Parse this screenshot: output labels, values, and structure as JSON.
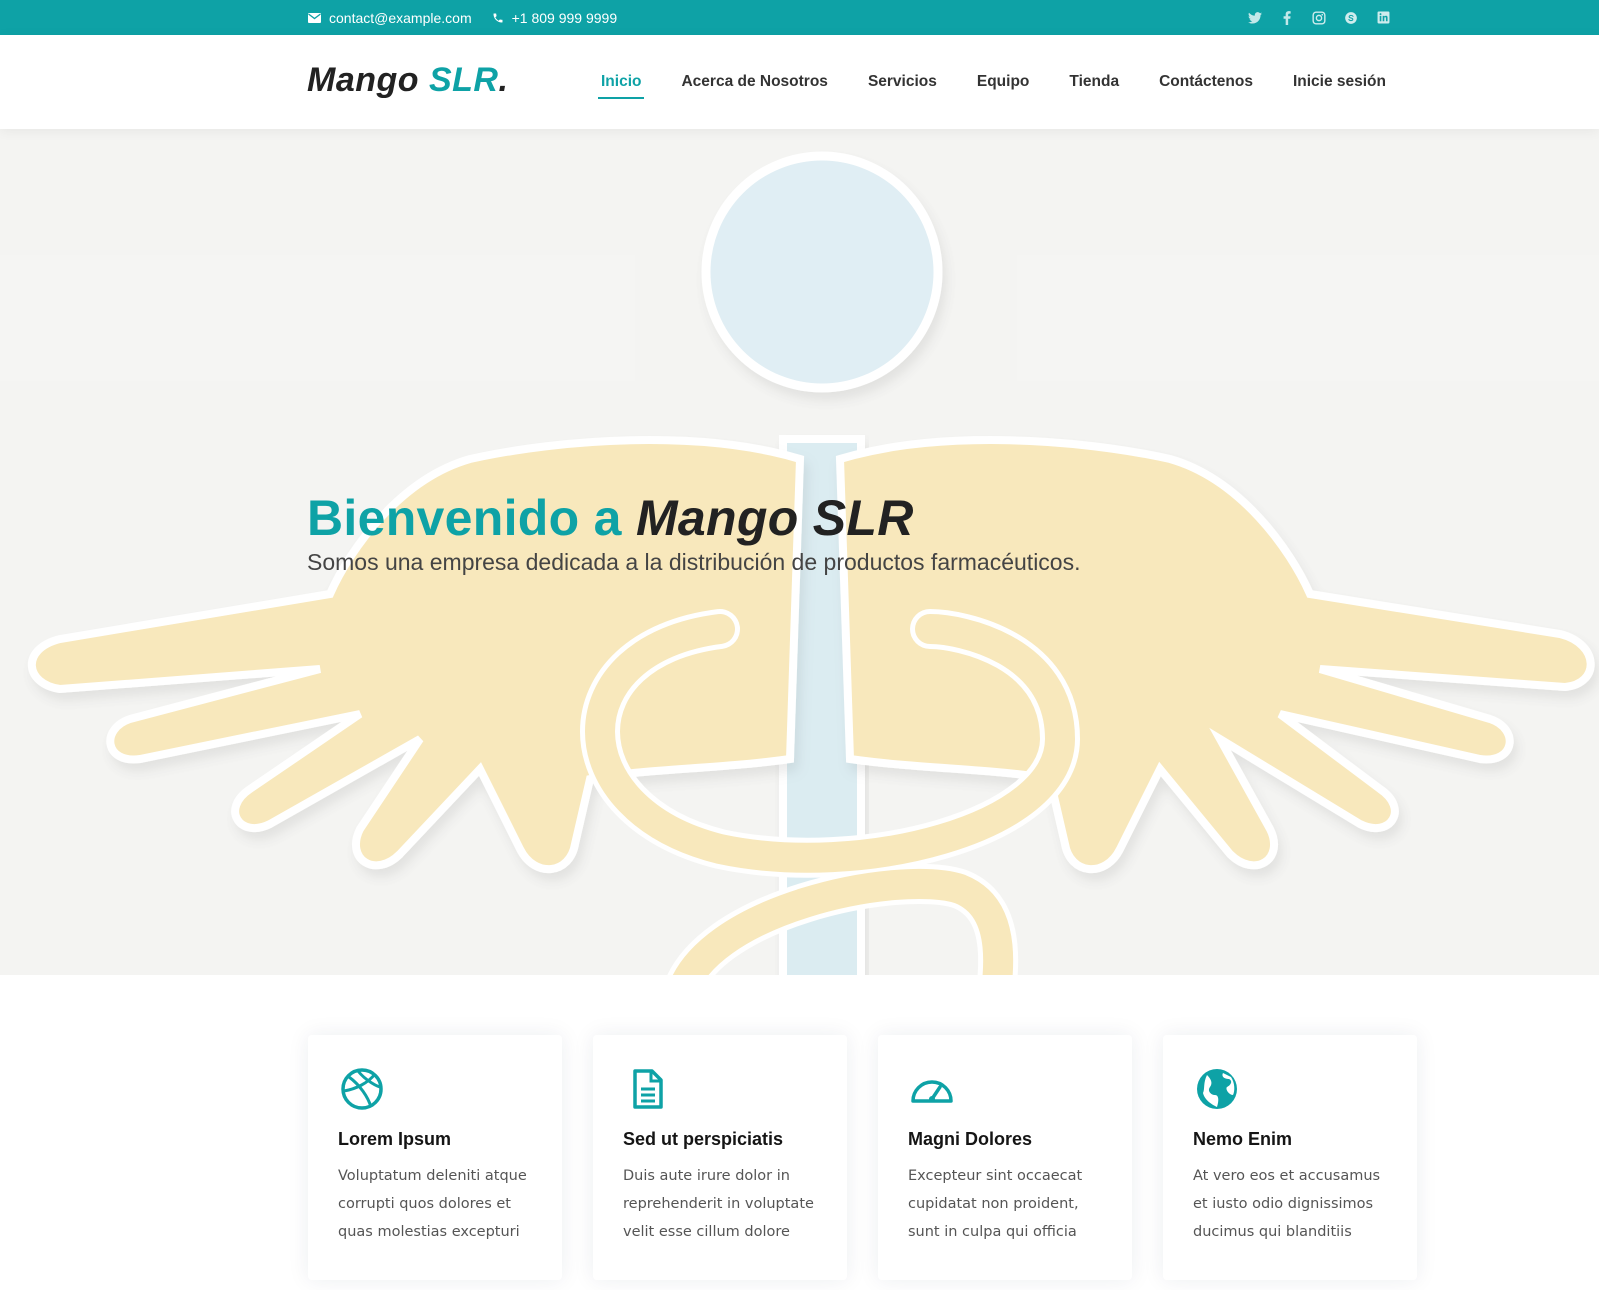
{
  "topbar": {
    "email": "contact@example.com",
    "phone": "+1 809 999 9999",
    "social_icons": [
      "twitter-icon",
      "facebook-icon",
      "instagram-icon",
      "skype-icon",
      "linkedin-icon"
    ]
  },
  "header": {
    "logo_main": "Mango ",
    "logo_accent": "SLR",
    "logo_dot": ".",
    "nav": [
      {
        "label": "Inicio",
        "active": true
      },
      {
        "label": "Acerca de Nosotros"
      },
      {
        "label": "Servicios"
      },
      {
        "label": "Equipo"
      },
      {
        "label": "Tienda"
      },
      {
        "label": "Contáctenos"
      },
      {
        "label": "Inicie sesión"
      }
    ]
  },
  "hero": {
    "title_prefix": "Bienvenido a ",
    "title_name": "Mango SLR",
    "subtitle": "Somos una empresa dedicada a la distribución de productos farmacéuticos."
  },
  "features": [
    {
      "icon": "dribbble-icon",
      "title": "Lorem Ipsum",
      "text_lines": [
        "Voluptatum deleniti atque",
        "corrupti quos dolores et",
        "quas molestias excepturi"
      ]
    },
    {
      "icon": "document-icon",
      "title": "Sed ut perspiciatis",
      "text_lines": [
        "Duis aute irure dolor in",
        "reprehenderit in voluptate",
        "velit esse cillum dolore"
      ]
    },
    {
      "icon": "speedometer-icon",
      "title": "Magni Dolores",
      "text_lines": [
        "Excepteur sint occaecat",
        "cupidatat non proident,",
        "sunt in culpa qui officia"
      ]
    },
    {
      "icon": "globe-icon",
      "title": "Nemo Enim",
      "text_lines": [
        "At vero eos et accusamus",
        "et iusto odio dignissimos",
        "ducimus qui blanditiis"
      ]
    }
  ],
  "colors": {
    "accent": "#0ea2a6",
    "hands": "#f4dc98",
    "staff": "#c8e2ea"
  }
}
